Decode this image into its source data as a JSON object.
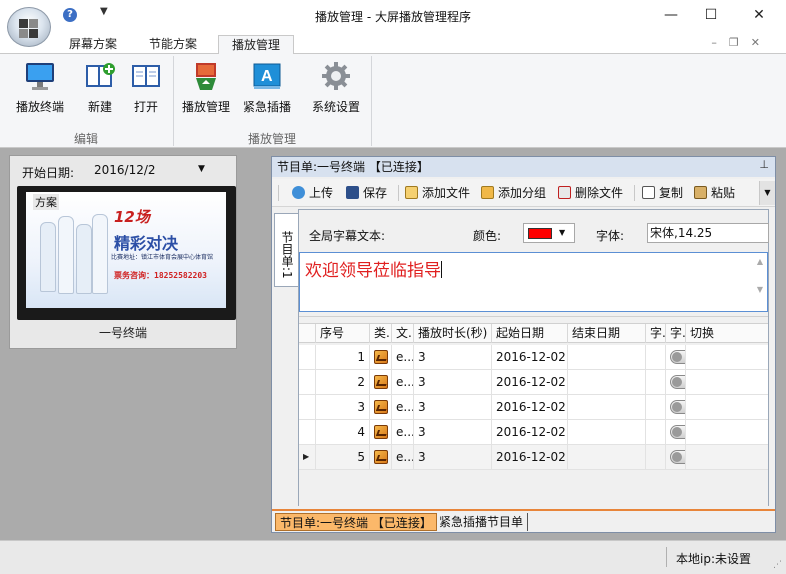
{
  "window": {
    "title": "播放管理 - 大屏播放管理程序",
    "controls": [
      "minimize",
      "maximize",
      "close"
    ]
  },
  "ribbon": {
    "tabs": [
      {
        "label": "屏幕方案"
      },
      {
        "label": "节能方案"
      },
      {
        "label": "播放管理",
        "active": true
      }
    ],
    "groups": [
      {
        "label": "编辑",
        "buttons": [
          {
            "label": "播放终端",
            "icon": "monitor-icon"
          },
          {
            "label": "新建",
            "icon": "new-book-icon"
          },
          {
            "label": "打开",
            "icon": "open-book-icon"
          }
        ]
      },
      {
        "label": "播放管理",
        "buttons": [
          {
            "label": "播放管理",
            "icon": "playlist-icon"
          },
          {
            "label": "紧急插播",
            "icon": "emergency-text-icon"
          },
          {
            "label": "系统设置",
            "icon": "gear-icon"
          }
        ]
      }
    ]
  },
  "left_panel": {
    "start_date_label": "开始日期:",
    "start_date_value": "2016/12/2",
    "preview_badge": "方案",
    "poster": {
      "headline": "精彩对决",
      "number": "12场",
      "address": "比赛地址：镇江市体育会展中心体育馆",
      "phone": "票务咨询：18252582203"
    },
    "terminal_name": "一号终端"
  },
  "right_panel": {
    "header": "节目单:一号终端 【已连接】",
    "toolbar": [
      {
        "label": "上传",
        "icon": "upload-icon"
      },
      {
        "label": "保存",
        "icon": "save-icon"
      },
      {
        "label": "添加文件",
        "icon": "add-file-icon"
      },
      {
        "label": "添加分组",
        "icon": "add-group-icon"
      },
      {
        "label": "删除文件",
        "icon": "delete-file-icon"
      },
      {
        "label": "复制",
        "icon": "copy-icon"
      },
      {
        "label": "粘贴",
        "icon": "paste-icon"
      }
    ],
    "vertical_tab": "节目单:1",
    "global_subtitle_label": "全局字幕文本:",
    "color_label": "颜色:",
    "color_value": "#ff0000",
    "font_label": "字体:",
    "font_value": "宋体,14.25",
    "subtitle_text": "欢迎领导莅临指导",
    "grid": {
      "columns": [
        "序号",
        "类.",
        "文.",
        "播放时长(秒)",
        "起始日期",
        "结束日期",
        "字.",
        "字.",
        "切换"
      ],
      "rows": [
        {
          "index": "1",
          "file": "e...",
          "duration": "3",
          "start": "2016-12-02",
          "end": ""
        },
        {
          "index": "2",
          "file": "e...",
          "duration": "3",
          "start": "2016-12-02",
          "end": ""
        },
        {
          "index": "3",
          "file": "e...",
          "duration": "3",
          "start": "2016-12-02",
          "end": ""
        },
        {
          "index": "4",
          "file": "e...",
          "duration": "3",
          "start": "2016-12-02",
          "end": ""
        },
        {
          "index": "5",
          "file": "e...",
          "duration": "3",
          "start": "2016-12-02",
          "end": "",
          "current": true
        }
      ]
    },
    "bottom_tabs": [
      {
        "label": "节目单:一号终端 【已连接】",
        "active": true
      },
      {
        "label": "紧急插播节目单"
      }
    ]
  },
  "status_bar": {
    "local_ip": "本地ip:未设置"
  }
}
